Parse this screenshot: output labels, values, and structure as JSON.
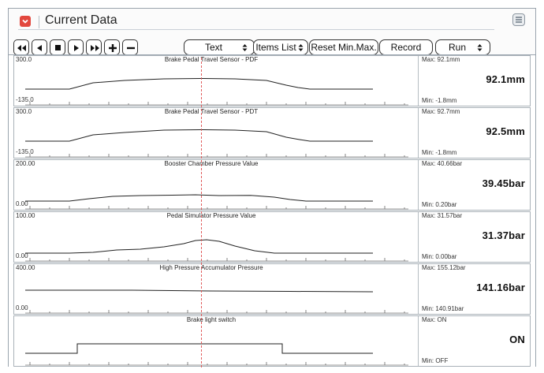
{
  "window": {
    "title": "Current Data",
    "colors": {
      "accent": "#e2483e",
      "cursor": "#e05a5a"
    }
  },
  "toolbar": {
    "nav_buttons": [
      {
        "icon": "rewind-icon"
      },
      {
        "icon": "step-back-icon"
      },
      {
        "icon": "stop-icon"
      },
      {
        "icon": "play-icon"
      },
      {
        "icon": "fast-forward-icon"
      },
      {
        "icon": "plus-icon"
      },
      {
        "icon": "minus-icon"
      }
    ],
    "view_mode": "Text",
    "items_list": "Items List",
    "reset_label": "Reset Min.Max.",
    "record_label": "Record",
    "run_mode": "Run"
  },
  "parameters": [
    {
      "name": "Brake Pedal Travel Sensor - PDF",
      "y_max": "300.0",
      "y_min": "-135.0",
      "max_label": "Max: 92.1mm",
      "min_label": "Min: -1.8mm",
      "current": "92.1mm"
    },
    {
      "name": "Brake Pedal Travel Sensor - PDT",
      "y_max": "300.0",
      "y_min": "-135.0",
      "max_label": "Max: 92.7mm",
      "min_label": "Min: -1.8mm",
      "current": "92.5mm"
    },
    {
      "name": "Booster Chamber Pressure Value",
      "y_max": "200.00",
      "y_min": "0.00",
      "max_label": "Max: 40.66bar",
      "min_label": "Min: 0.20bar",
      "current": "39.45bar"
    },
    {
      "name": "Pedal Simulator Pressure Value",
      "y_max": "100.00",
      "y_min": "0.00",
      "max_label": "Max: 31.57bar",
      "min_label": "Min: 0.00bar",
      "current": "31.37bar"
    },
    {
      "name": "High Pressure Accumulator Pressure",
      "y_max": "400.00",
      "y_min": "0.00",
      "max_label": "Max: 155.12bar",
      "min_label": "Min: 140.91bar",
      "current": "141.16bar"
    },
    {
      "name": "Brake light switch",
      "y_max": "",
      "y_min": "",
      "max_label": "Max: ON",
      "min_label": "Min: OFF",
      "current": "ON"
    }
  ]
}
